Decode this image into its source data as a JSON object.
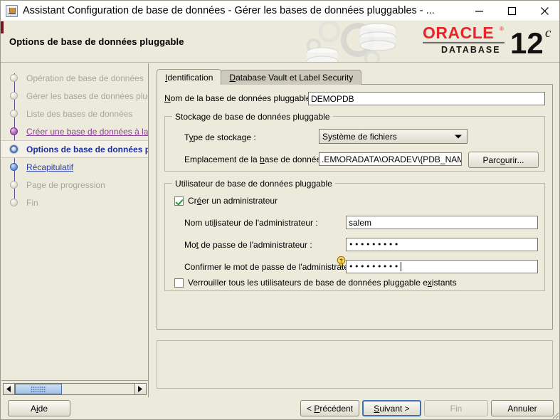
{
  "window": {
    "title": "Assistant Configuration de base de données - Gérer les bases de données pluggables - ...",
    "app_icon": "java-coffee-cup-icon",
    "minimize": "minimize-icon",
    "maximize": "maximize-icon",
    "close": "close-icon"
  },
  "banner": {
    "title": "Options de base de données pluggable",
    "brand": "ORACLE",
    "brand_sub": "DATABASE",
    "version_number": "12",
    "version_suffix": "c",
    "accent_color": "#7a1420",
    "brand_color": "#e8262a"
  },
  "sidebar": {
    "steps": [
      {
        "label": "Opération de base de données",
        "state": "done"
      },
      {
        "label": "Gérer les bases de données plugg",
        "state": "done"
      },
      {
        "label": "Liste des bases de données",
        "state": "done"
      },
      {
        "label": "Créer une base de données à la c",
        "state": "visited"
      },
      {
        "label": "Options de base de données p",
        "state": "active"
      },
      {
        "label": "Récapitulatif",
        "state": "next"
      },
      {
        "label": "Page de progression",
        "state": "done"
      },
      {
        "label": "Fin",
        "state": "done"
      }
    ],
    "scrollbar": {
      "left_arrow": "scroll-left-icon",
      "right_arrow": "scroll-right-icon"
    }
  },
  "main": {
    "tabs": [
      {
        "label": "Identification",
        "active": true
      },
      {
        "label": "Database Vault et Label Security",
        "active": false
      }
    ],
    "pdb_name_label": "Nom de la base de données pluggable :",
    "pdb_name_value": "DEMOPDB",
    "storage_group": {
      "title": "Stockage de base de données pluggable",
      "storage_type_label": "Type de stockage :",
      "storage_type_value": "Système de fichiers",
      "location_label": "Emplacement de la base de données :",
      "location_value": ".EM\\ORADATA\\ORADEV\\{PDB_NAME}",
      "browse_button": "Parcourir..."
    },
    "user_group": {
      "title": "Utilisateur de base de données pluggable",
      "create_admin_label": "Créer un administrateur",
      "create_admin_checked": true,
      "admin_user_label": "Nom utilisateur de l'administrateur :",
      "admin_user_value": "salem",
      "admin_pwd_label": "Mot de passe de l'administrateur :",
      "admin_pwd_value": "•••••••••",
      "confirm_pwd_label": "Confirmer le mot de passe de l'administrateur :",
      "confirm_pwd_value": "•••••••••",
      "help_icon": "help-balloon-icon",
      "lock_users_label": "Verrouiller tous les utilisateurs de base de données pluggable existants",
      "lock_users_checked": false
    }
  },
  "buttons": {
    "help": "Aide",
    "back": "< Précédent",
    "next": "Suivant >",
    "finish": "Fin",
    "cancel": "Annuler"
  }
}
